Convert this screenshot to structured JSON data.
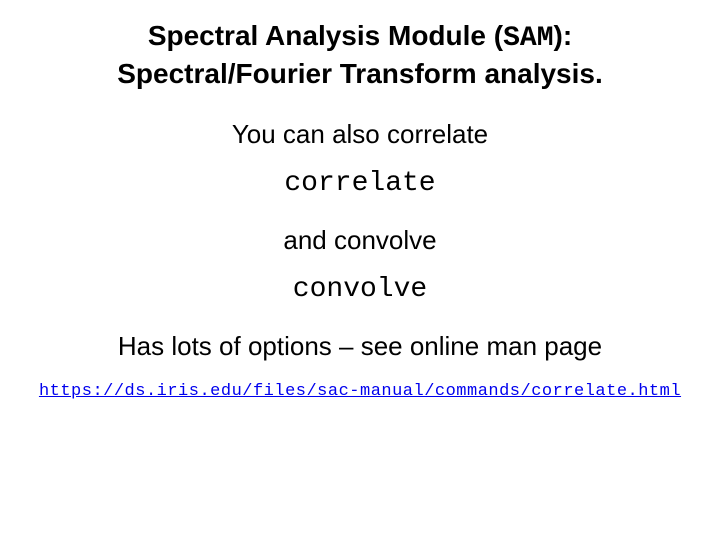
{
  "title": {
    "prefix": "Spectral Analysis Module (",
    "acronym": "SAM",
    "suffix_line1": "):",
    "line2": "Spectral/Fourier Transform analysis."
  },
  "lines": {
    "also_correlate": "You can also correlate",
    "cmd_correlate": "correlate",
    "and_convolve": "and convolve",
    "cmd_convolve": "convolve",
    "man_note": "Has lots of options – see online man page"
  },
  "link": {
    "text": "https://ds.iris.edu/files/sac-manual/commands/correlate.html",
    "href": "https://ds.iris.edu/files/sac-manual/commands/correlate.html"
  }
}
